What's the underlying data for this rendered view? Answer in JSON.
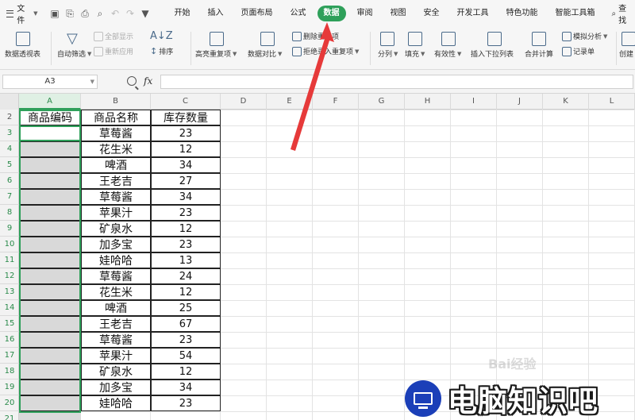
{
  "menubar": {
    "file_label": "文件",
    "tabs": [
      "开始",
      "插入",
      "页面布局",
      "公式",
      "数据",
      "审阅",
      "视图",
      "安全",
      "开发工具",
      "特色功能",
      "智能工具箱"
    ],
    "active_tab": "数据",
    "search_label": "查找"
  },
  "ribbon": {
    "pivot_table": "数据透视表",
    "auto_filter": "自动筛选",
    "show_all": "全部显示",
    "reapply": "重新应用",
    "sort": "排序",
    "highlight_dup": "高亮重复项",
    "data_compare": "数据对比",
    "remove_dup": "删除重复项",
    "reject_dup": "拒绝录入重复项",
    "split_column": "分列",
    "fill": "填充",
    "validity": "有效性",
    "insert_dropdown": "插入下拉列表",
    "consolidate": "合并计算",
    "simulation": "模拟分析",
    "record_sheet": "记录单",
    "create_group": "创建"
  },
  "formula_bar": {
    "name_box": "A3",
    "fx_label": "fx",
    "formula": ""
  },
  "sheet": {
    "columns": [
      "A",
      "B",
      "C",
      "D",
      "E",
      "F",
      "G",
      "H",
      "I",
      "J",
      "K",
      "L"
    ],
    "selected_column": "A",
    "rows": [
      "2",
      "3",
      "4",
      "5",
      "6",
      "7",
      "8",
      "9",
      "10",
      "11",
      "12",
      "13",
      "14",
      "15",
      "16",
      "17",
      "18",
      "19",
      "20",
      "21"
    ],
    "header": [
      "商品编码",
      "商品名称",
      "库存数量"
    ],
    "data": [
      [
        "",
        "草莓酱",
        "23"
      ],
      [
        "",
        "花生米",
        "12"
      ],
      [
        "",
        "啤酒",
        "34"
      ],
      [
        "",
        "王老吉",
        "27"
      ],
      [
        "",
        "草莓酱",
        "34"
      ],
      [
        "",
        "苹果汁",
        "23"
      ],
      [
        "",
        "矿泉水",
        "12"
      ],
      [
        "",
        "加多宝",
        "23"
      ],
      [
        "",
        "娃哈哈",
        "13"
      ],
      [
        "",
        "草莓酱",
        "24"
      ],
      [
        "",
        "花生米",
        "12"
      ],
      [
        "",
        "啤酒",
        "25"
      ],
      [
        "",
        "王老吉",
        "67"
      ],
      [
        "",
        "草莓酱",
        "23"
      ],
      [
        "",
        "苹果汁",
        "54"
      ],
      [
        "",
        "矿泉水",
        "12"
      ],
      [
        "",
        "加多宝",
        "34"
      ],
      [
        "",
        "娃哈哈",
        "23"
      ]
    ]
  },
  "watermark": {
    "text": "电脑知识吧",
    "baidu": "Bai经验"
  },
  "colors": {
    "accent_green": "#2ea05a",
    "arrow_red": "#e63a3a",
    "watermark_blue": "#1b3fb8"
  }
}
